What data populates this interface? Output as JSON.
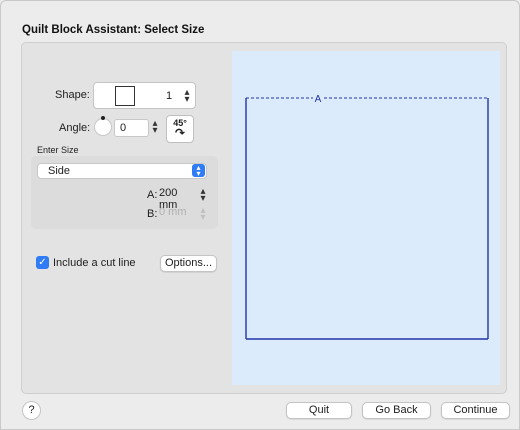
{
  "window": {
    "title": "Quilt Block Assistant: Select Size"
  },
  "shape": {
    "label": "Shape:",
    "count": "1",
    "icon": "square-shape-icon"
  },
  "angle": {
    "label": "Angle:",
    "value": "0",
    "rotate_button": {
      "degrees": "45°",
      "arrow": "↷"
    }
  },
  "enter_size": {
    "heading": "Enter Size",
    "mode_selected": "Side",
    "a_label": "A:",
    "a_value": "200 mm",
    "b_label": "B:",
    "b_value": "0 mm"
  },
  "cut_line": {
    "checked": true,
    "check_glyph": "✓",
    "label": "Include a cut line",
    "options_button": "Options..."
  },
  "preview": {
    "edge_label": "A",
    "fill_color": "#dcebfb",
    "line_color": "#1f35a8"
  },
  "footer": {
    "help": "?",
    "quit": "Quit",
    "go_back": "Go Back",
    "continue": "Continue"
  },
  "colors": {
    "accent": "#2f7cf6",
    "panel": "#e3e3e3"
  }
}
